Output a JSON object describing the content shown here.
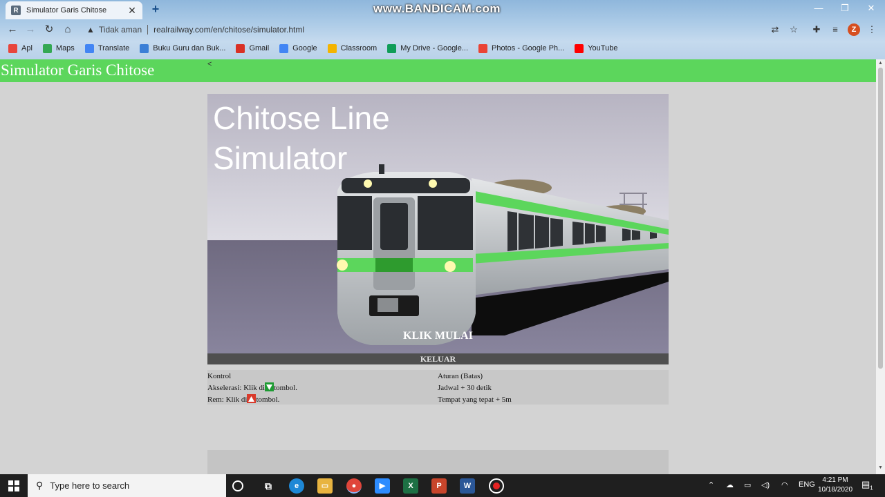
{
  "browser": {
    "tab_title": "Simulator Garis Chitose",
    "tab_favicon_letter": "R",
    "watermark": "www.BANDICAM.com",
    "security_label": "Tidak aman",
    "url": "realrailway.com/en/chitose/simulator.html",
    "profile_initial": "Z"
  },
  "bookmarks": [
    {
      "label": "Apl",
      "icon": "apps-grid-icon",
      "color": "#e8453c"
    },
    {
      "label": "Maps",
      "icon": "maps-pin-icon",
      "color": "#34a853"
    },
    {
      "label": "Translate",
      "icon": "translate-icon",
      "color": "#4285f4"
    },
    {
      "label": "Buku Guru dan Buk...",
      "icon": "globe-icon",
      "color": "#3b7fd6"
    },
    {
      "label": "Gmail",
      "icon": "gmail-icon",
      "color": "#d93025"
    },
    {
      "label": "Google",
      "icon": "google-icon",
      "color": "#4285f4"
    },
    {
      "label": "Classroom",
      "icon": "classroom-icon",
      "color": "#f4b400"
    },
    {
      "label": "My Drive - Google...",
      "icon": "drive-icon",
      "color": "#0f9d58"
    },
    {
      "label": "Photos - Google Ph...",
      "icon": "photos-icon",
      "color": "#ea4335"
    },
    {
      "label": "YouTube",
      "icon": "youtube-icon",
      "color": "#ff0000"
    }
  ],
  "site": {
    "header_title": "Simulator Garis Chitose",
    "header_caret": "<"
  },
  "game": {
    "title": "Chitose Line Simulator",
    "start_label": "KLIK MULAI",
    "exit_label": "KELUAR",
    "train_stripe_color": "#5cd65c"
  },
  "controls": {
    "heading": "Kontrol",
    "accel_prefix": "Akselerasi: Klik di",
    "accel_suffix": "tombol.",
    "brake_prefix": "Rem: Klik di",
    "brake_suffix": "tombol.",
    "accel_color": "#1d9b32",
    "brake_color": "#d93a2b"
  },
  "rules": {
    "heading": "Aturan (Batas)",
    "line1": "Jadwal + 30 detik",
    "line2": "Tempat yang tepat + 5m"
  },
  "taskbar": {
    "search_placeholder": "Type here to search",
    "lang": "ENG",
    "time": "4:21 PM",
    "date": "10/18/2020",
    "notification_count": "1"
  }
}
